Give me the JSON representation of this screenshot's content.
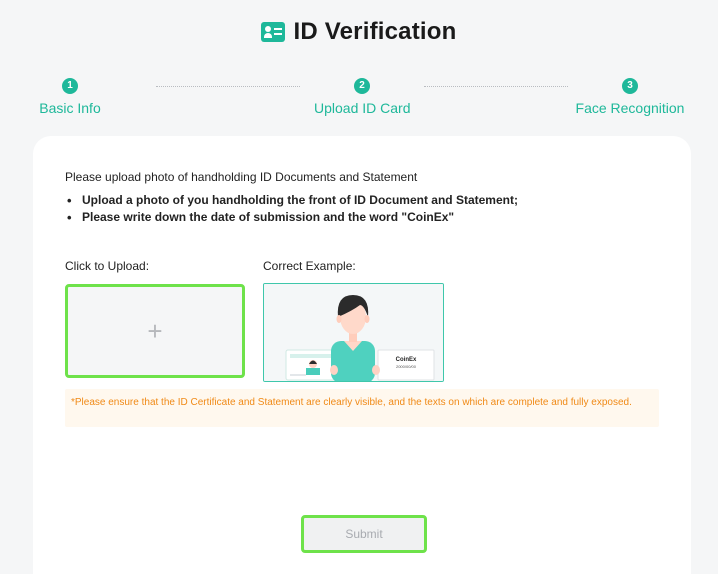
{
  "header": {
    "title": "ID Verification",
    "icon": "id-card-icon",
    "accent_color": "#1eb89a"
  },
  "steps": [
    {
      "number": "1",
      "label": "Basic Info"
    },
    {
      "number": "2",
      "label": "Upload ID Card"
    },
    {
      "number": "3",
      "label": "Face Recognition"
    }
  ],
  "card": {
    "intro": "Please upload photo of handholding ID Documents and Statement",
    "bullets": [
      "Upload a photo of you handholding the front of ID Document and Statement;",
      "Please write down the date of submission and the word \"CoinEx\""
    ],
    "upload_label": "Click to Upload:",
    "upload_icon": "plus-icon",
    "example_label": "Correct Example:",
    "example_image": {
      "statement_word": "CoinEx",
      "statement_date": "2000/00/00"
    },
    "notice": "*Please ensure that the ID Certificate and Statement are clearly visible, and the texts on which are complete and fully exposed.",
    "notice_color": "#f08a17",
    "submit_label": "Submit",
    "highlight_color": "#6ee24a"
  }
}
